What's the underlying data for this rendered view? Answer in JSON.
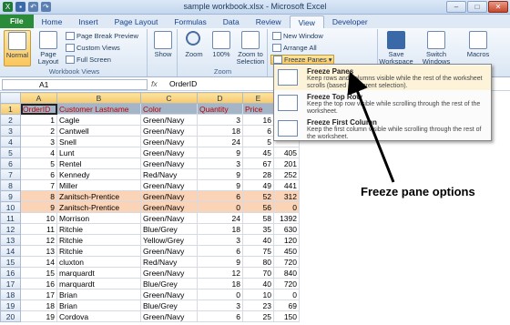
{
  "window": {
    "title": "sample workbook.xlsx - Microsoft Excel",
    "minimize": "–",
    "maximize": "□",
    "close": "✕"
  },
  "tabs": [
    "File",
    "Home",
    "Insert",
    "Page Layout",
    "Formulas",
    "Data",
    "Review",
    "View",
    "Developer"
  ],
  "active_tab": "View",
  "ribbon": {
    "workbook_views": {
      "label": "Workbook Views",
      "normal": "Normal",
      "page_layout": "Page Layout",
      "page_break_preview": "Page Break Preview",
      "custom_views": "Custom Views",
      "full_screen": "Full Screen"
    },
    "show": {
      "label": "Show"
    },
    "zoom": {
      "label": "Zoom",
      "zoom": "Zoom",
      "hundred": "100%",
      "zoom_to_selection": "Zoom to Selection"
    },
    "window": {
      "new_window": "New Window",
      "arrange_all": "Arrange All",
      "freeze_panes": "Freeze Panes"
    },
    "save_workspace": "Save Workspace",
    "switch_windows": "Switch Windows",
    "macros": "Macros"
  },
  "formula_bar": {
    "name_box": "A1",
    "fx": "fx",
    "value": "OrderID"
  },
  "columns": [
    "A",
    "B",
    "C",
    "D",
    "E"
  ],
  "rows": [
    {
      "n": "1",
      "cells": [
        "OrderID",
        "Customer Lastname",
        "Color",
        "Quantity",
        "Price"
      ]
    },
    {
      "n": "2",
      "cells": [
        "1",
        "Cagle",
        "Green/Navy",
        "3",
        "16"
      ]
    },
    {
      "n": "3",
      "cells": [
        "2",
        "Cantwell",
        "Green/Navy",
        "18",
        "6"
      ]
    },
    {
      "n": "4",
      "cells": [
        "3",
        "Snell",
        "Green/Navy",
        "24",
        "5"
      ]
    },
    {
      "n": "5",
      "cells": [
        "4",
        "Lunt",
        "Green/Navy",
        "9",
        "45",
        "405"
      ]
    },
    {
      "n": "6",
      "cells": [
        "5",
        "Rentel",
        "Green/Navy",
        "3",
        "67",
        "201"
      ]
    },
    {
      "n": "7",
      "cells": [
        "6",
        "Kennedy",
        "Red/Navy",
        "9",
        "28",
        "252"
      ]
    },
    {
      "n": "8",
      "cells": [
        "7",
        "Miller",
        "Green/Navy",
        "9",
        "49",
        "441"
      ]
    },
    {
      "n": "9",
      "cells": [
        "8",
        "Zanitsch-Prentice",
        "Green/Navy",
        "6",
        "52",
        "312"
      ]
    },
    {
      "n": "10",
      "cells": [
        "9",
        "Zanitsch-Prentice",
        "Green/Navy",
        "0",
        "56",
        "0"
      ]
    },
    {
      "n": "11",
      "cells": [
        "10",
        "Morrison",
        "Green/Navy",
        "24",
        "58",
        "1392"
      ]
    },
    {
      "n": "12",
      "cells": [
        "11",
        "Ritchie",
        "Blue/Grey",
        "18",
        "35",
        "630"
      ]
    },
    {
      "n": "13",
      "cells": [
        "12",
        "Ritchie",
        "Yellow/Grey",
        "3",
        "40",
        "120"
      ]
    },
    {
      "n": "14",
      "cells": [
        "13",
        "Ritchie",
        "Green/Navy",
        "6",
        "75",
        "450"
      ]
    },
    {
      "n": "15",
      "cells": [
        "14",
        "cluxton",
        "Red/Navy",
        "9",
        "80",
        "720"
      ]
    },
    {
      "n": "16",
      "cells": [
        "15",
        "marquardt",
        "Green/Navy",
        "12",
        "70",
        "840"
      ]
    },
    {
      "n": "17",
      "cells": [
        "16",
        "marquardt",
        "Blue/Grey",
        "18",
        "40",
        "720"
      ]
    },
    {
      "n": "18",
      "cells": [
        "17",
        "Brian",
        "Green/Navy",
        "0",
        "10",
        "0"
      ]
    },
    {
      "n": "19",
      "cells": [
        "18",
        "Brian",
        "Blue/Grey",
        "3",
        "23",
        "69"
      ]
    },
    {
      "n": "20",
      "cells": [
        "19",
        "Cordova",
        "Green/Navy",
        "6",
        "25",
        "150"
      ]
    }
  ],
  "freeze_menu": [
    {
      "title": "Freeze Panes",
      "desc": "Keep rows and columns visible while the rest of the worksheet scrolls (based on current selection)."
    },
    {
      "title": "Freeze Top Row",
      "desc": "Keep the top row visible while scrolling through the rest of the worksheet."
    },
    {
      "title": "Freeze First Column",
      "desc": "Keep the first column visible while scrolling through the rest of the worksheet."
    }
  ],
  "annotation": "Freeze pane options",
  "colors": {
    "file_tab": "#2a8c39",
    "header_row": "#a5b5c8",
    "header_text": "#c00000",
    "highlight_row": "#fbd3b6"
  }
}
